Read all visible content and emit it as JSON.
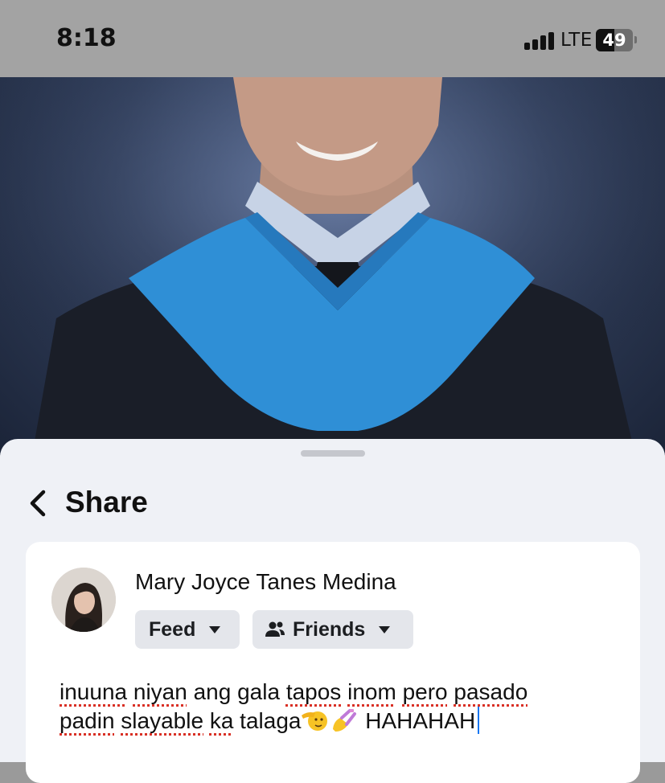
{
  "status_bar": {
    "time": "8:18",
    "network": "LTE",
    "battery": "49",
    "battery_level": 0.49
  },
  "share_sheet": {
    "title": "Share",
    "user": {
      "name": "Mary Joyce Tanes Medina"
    },
    "audience": {
      "feed_label": "Feed",
      "friends_label": "Friends"
    },
    "post": {
      "words_line1": [
        "inuuna",
        "niyan",
        "ang",
        "gala",
        "tapos",
        "inom",
        "pero",
        "pasado"
      ],
      "words_line2_before_emoji": [
        "padin",
        "slayable",
        "ka",
        "talaga"
      ],
      "after_emoji": "HAHAHAH",
      "emojis": [
        "saluting-face-emoji",
        "nail-polish-emoji"
      ]
    }
  },
  "colors": {
    "accent_caret": "#1877f2",
    "spellcheck": "#d93025",
    "graduation_hood": "#2f8fd6"
  }
}
